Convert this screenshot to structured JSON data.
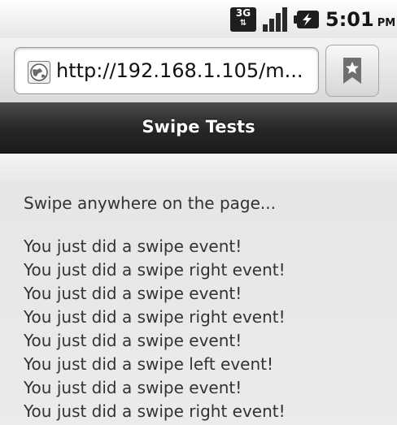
{
  "status_bar": {
    "network": "3G",
    "network_arrows": "⇅",
    "time": "5:01",
    "ampm": "PM",
    "icons": [
      "signal-icon",
      "battery-charging-icon"
    ]
  },
  "browser": {
    "url": "http://192.168.1.105/m...",
    "icons": [
      "globe-icon",
      "bookmark-icon"
    ]
  },
  "page": {
    "title": "Swipe Tests",
    "instruction": "Swipe anywhere on the page...",
    "events": [
      "You just did a swipe event!",
      "You just did a swipe right event!",
      "You just did a swipe event!",
      "You just did a swipe right event!",
      "You just did a swipe event!",
      "You just did a swipe left event!",
      "You just did a swipe event!",
      "You just did a swipe right event!"
    ]
  },
  "colors": {
    "header_bg": "#262626",
    "content_bg": "#ebebeb",
    "text": "#333333"
  }
}
